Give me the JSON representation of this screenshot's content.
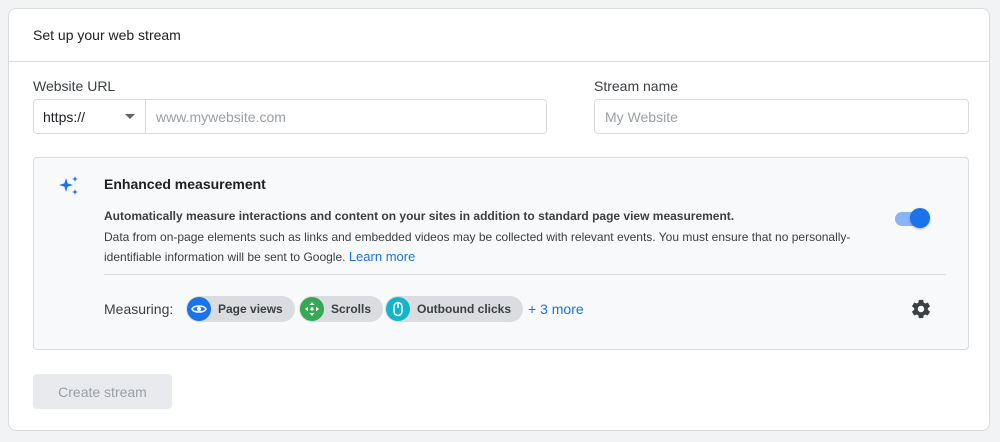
{
  "header": {
    "title": "Set up your web stream"
  },
  "website_url": {
    "label": "Website URL",
    "protocol": "https://",
    "placeholder": "www.mywebsite.com",
    "value": ""
  },
  "stream_name": {
    "label": "Stream name",
    "placeholder": "My Website",
    "value": ""
  },
  "enhanced_measurement": {
    "title": "Enhanced measurement",
    "description_bold": "Automatically measure interactions and content on your sites in addition to standard page view measurement.",
    "description": "Data from on-page elements such as links and embedded videos may be collected with relevant events. You must ensure that no personally-identifiable information will be sent to Google.",
    "learn_more": "Learn more",
    "enabled": true,
    "measuring_label": "Measuring:",
    "chips": [
      {
        "label": "Page views",
        "icon": "eye-icon",
        "color": "#1a73e8"
      },
      {
        "label": "Scrolls",
        "icon": "scroll-arrows-icon",
        "color": "#34a853"
      },
      {
        "label": "Outbound clicks",
        "icon": "mouse-icon",
        "color": "#12b5cb"
      }
    ],
    "more_label": "+ 3 more"
  },
  "actions": {
    "create_label": "Create stream",
    "create_disabled": true
  },
  "colors": {
    "accent": "#1a73e8",
    "toggle_track": "#8ab4f8"
  }
}
